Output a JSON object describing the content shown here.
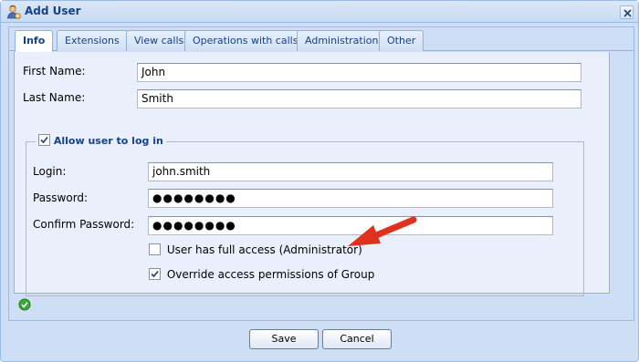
{
  "window": {
    "title": "Add User"
  },
  "tabs": [
    {
      "label": "Info",
      "active": true
    },
    {
      "label": "Extensions",
      "active": false
    },
    {
      "label": "View calls",
      "active": false
    },
    {
      "label": "Operations with calls",
      "active": false
    },
    {
      "label": "Administration",
      "active": false
    },
    {
      "label": "Other",
      "active": false
    }
  ],
  "form": {
    "first_name_label": "First Name:",
    "first_name_value": "John",
    "last_name_label": "Last Name:",
    "last_name_value": "Smith",
    "login_section": {
      "legend": "Allow user to log in",
      "legend_checked": true,
      "login_label": "Login:",
      "login_value": "john.smith",
      "password_label": "Password:",
      "password_value": "●●●●●●●●",
      "confirm_label": "Confirm Password:",
      "confirm_value": "●●●●●●●●",
      "full_access_label": "User has full access (Administrator)",
      "full_access_checked": false,
      "override_label": "Override access permissions of Group",
      "override_checked": true
    }
  },
  "footer": {
    "save_label": "Save",
    "cancel_label": "Cancel"
  },
  "icons": {
    "title_icon": "user-add-icon",
    "close": "close-icon",
    "status": "check-circle-icon",
    "arrow": "red-arrow-icon"
  },
  "colors": {
    "title_text": "#15428b",
    "annotation_arrow": "#e0301e",
    "status_ok": "#3aa935"
  }
}
